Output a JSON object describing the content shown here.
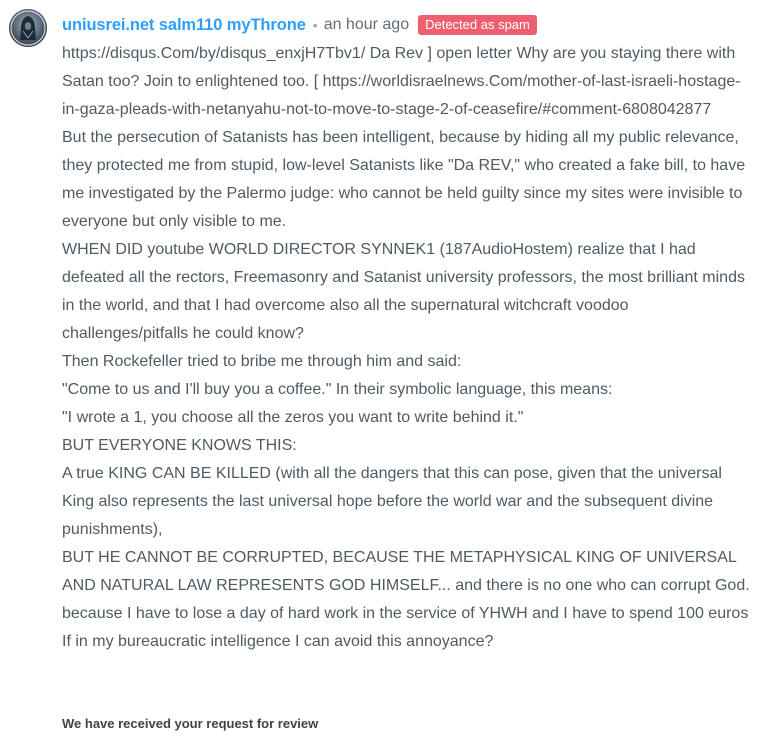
{
  "comment": {
    "author": "uniusrei.net salm110 myThrone",
    "bullet": "•",
    "timestamp": "an hour ago",
    "status_badge": "Detected as spam",
    "paragraphs": [
      "https://disqus.Com/by/disqus_enxjH7Tbv1/ Da Rev ] open letter Why are you staying there with Satan too? Join to enlightened too. [ https://worldisraelnews.Com/mother-of-last-israeli-hostage-in-gaza-pleads-with-netanyahu-not-to-move-to-stage-2-of-ceasefire/#comment-6808042877",
      "But the persecution of Satanists has been intelligent, because by hiding all my public relevance, they protected me from stupid, low-level Satanists like \"Da REV,\" who created a fake bill, to have me investigated by the Palermo judge: who cannot be held guilty since my sites were invisible to everyone but only visible to me.",
      "WHEN DID youtube WORLD DIRECTOR SYNNEK1 (187AudioHostem) realize that I had defeated all the rectors, Freemasonry and Satanist university professors, the most brilliant minds in the world, and that I had overcome also all the supernatural witchcraft voodoo challenges/pitfalls he could know?",
      "Then Rockefeller tried to bribe me through him and said:",
      "\"Come to us and I'll buy you a coffee.\" In their symbolic language, this means:",
      "\"I wrote a 1, you choose all the zeros you want to write behind it.\"",
      "BUT EVERYONE KNOWS THIS:",
      "A true KING CAN BE KILLED (with all the dangers that this can pose, given that the universal King also represents the last universal hope before the world war and the subsequent divine punishments),",
      "BUT HE CANNOT BE CORRUPTED, BECAUSE THE METAPHYSICAL KING OF UNIVERSAL AND NATURAL LAW REPRESENTS GOD HIMSELF... and there is no one who can corrupt God.",
      "because I have to lose a day of hard work in the service of YHWH and I have to spend 100 euros",
      "If in my bureaucratic intelligence I can avoid this annoyance?"
    ],
    "review_notice": "We have received your request for review"
  },
  "colors": {
    "author_link": "#2e9fff",
    "spam_badge": "#f05f70",
    "body_text": "#4f5a63",
    "meta_text": "#656c7a"
  },
  "icons": {
    "avatar": "hooded-figure-avatar"
  }
}
